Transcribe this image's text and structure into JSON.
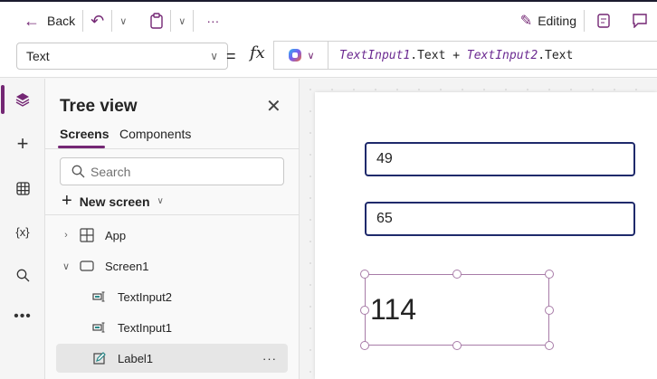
{
  "toolbar": {
    "back_label": "Back",
    "more_label": "···",
    "editing_label": "Editing"
  },
  "formula_bar": {
    "property": "Text",
    "equals": "=",
    "fx": "fx",
    "formula_parts": [
      {
        "text": "TextInput1",
        "italic": true
      },
      {
        "text": ".Text + ",
        "italic": false
      },
      {
        "text": "TextInput2",
        "italic": true
      },
      {
        "text": ".Text",
        "italic": false
      }
    ]
  },
  "rail": {
    "items": [
      "layers",
      "insert",
      "data",
      "variables",
      "search",
      "more"
    ]
  },
  "tree_view": {
    "title": "Tree view",
    "tabs": [
      "Screens",
      "Components"
    ],
    "search_placeholder": "Search",
    "new_screen_label": "New screen",
    "nodes": [
      {
        "label": "App"
      },
      {
        "label": "Screen1"
      },
      {
        "label": "TextInput2"
      },
      {
        "label": "TextInput1"
      },
      {
        "label": "Label1",
        "more": "···"
      }
    ]
  },
  "canvas": {
    "text_input_1_value": "49",
    "text_input_2_value": "65",
    "label_value": "114"
  },
  "colors": {
    "accent": "#742774",
    "input_border": "#1f2a6b",
    "selection": "#a87ca8"
  }
}
